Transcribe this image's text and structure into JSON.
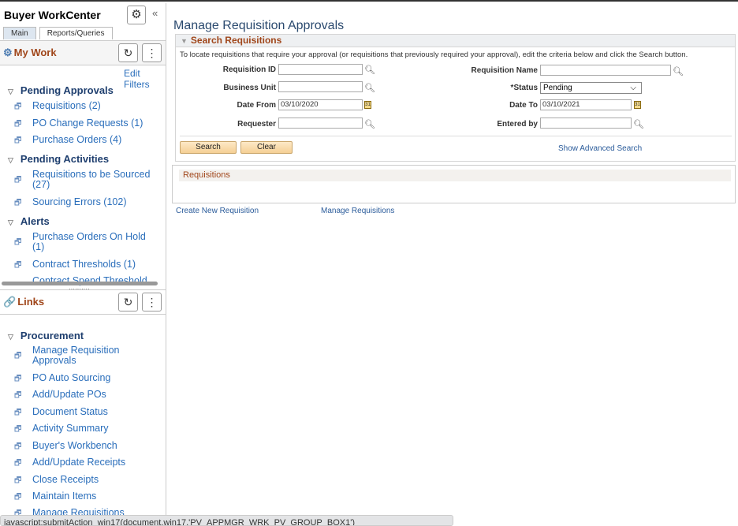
{
  "sidebar": {
    "title": "Buyer WorkCenter",
    "tabs": [
      "Main",
      "Reports/Queries"
    ],
    "my_work": {
      "title": "My Work",
      "edit_filters": "Edit Filters",
      "groups": [
        {
          "label": "Pending Approvals",
          "items": [
            "Requisitions (2)",
            "PO Change Requests (1)",
            "Purchase Orders (4)"
          ]
        },
        {
          "label": "Pending Activities",
          "items": [
            "Requisitions to be Sourced (27)",
            "Sourcing Errors (102)"
          ]
        },
        {
          "label": "Alerts",
          "items": [
            "Purchase Orders On Hold (1)",
            "Contract Thresholds (1)",
            "Contract Spend Threshold"
          ]
        }
      ]
    },
    "links": {
      "title": "Links",
      "group": "Procurement",
      "items": [
        "Manage Requisition Approvals",
        "PO Auto Sourcing",
        "Add/Update POs",
        "Document Status",
        "Activity Summary",
        "Buyer's Workbench",
        "Add/Update Receipts",
        "Close Receipts",
        "Maintain Items",
        "Manage Requisitions"
      ]
    }
  },
  "main": {
    "title": "Manage Requisition Approvals",
    "section_title": "Search Requisitions",
    "instructions": "To locate requisitions that require your approval (or requisitions that previously required your approval), edit the criteria below and click the Search button.",
    "fields": {
      "requisition_id": {
        "label": "Requisition ID",
        "value": ""
      },
      "business_unit": {
        "label": "Business Unit",
        "value": ""
      },
      "date_from": {
        "label": "Date From",
        "value": "03/10/2020"
      },
      "requester": {
        "label": "Requester",
        "value": ""
      },
      "requisition_name": {
        "label": "Requisition Name",
        "value": ""
      },
      "status": {
        "label": "*Status",
        "value": "Pending"
      },
      "date_to": {
        "label": "Date To",
        "value": "03/10/2021"
      },
      "entered_by": {
        "label": "Entered by",
        "value": ""
      }
    },
    "search_label": "Search",
    "clear_label": "Clear",
    "advanced_search": "Show Advanced Search",
    "requisitions_header": "Requisitions",
    "create_new": "Create New Requisition",
    "manage_requisitions": "Manage Requisitions"
  },
  "status_bar": "javascript:submitAction_win17(document.win17,'PV_APPMGR_WRK_PV_GROUP_BOX1')"
}
